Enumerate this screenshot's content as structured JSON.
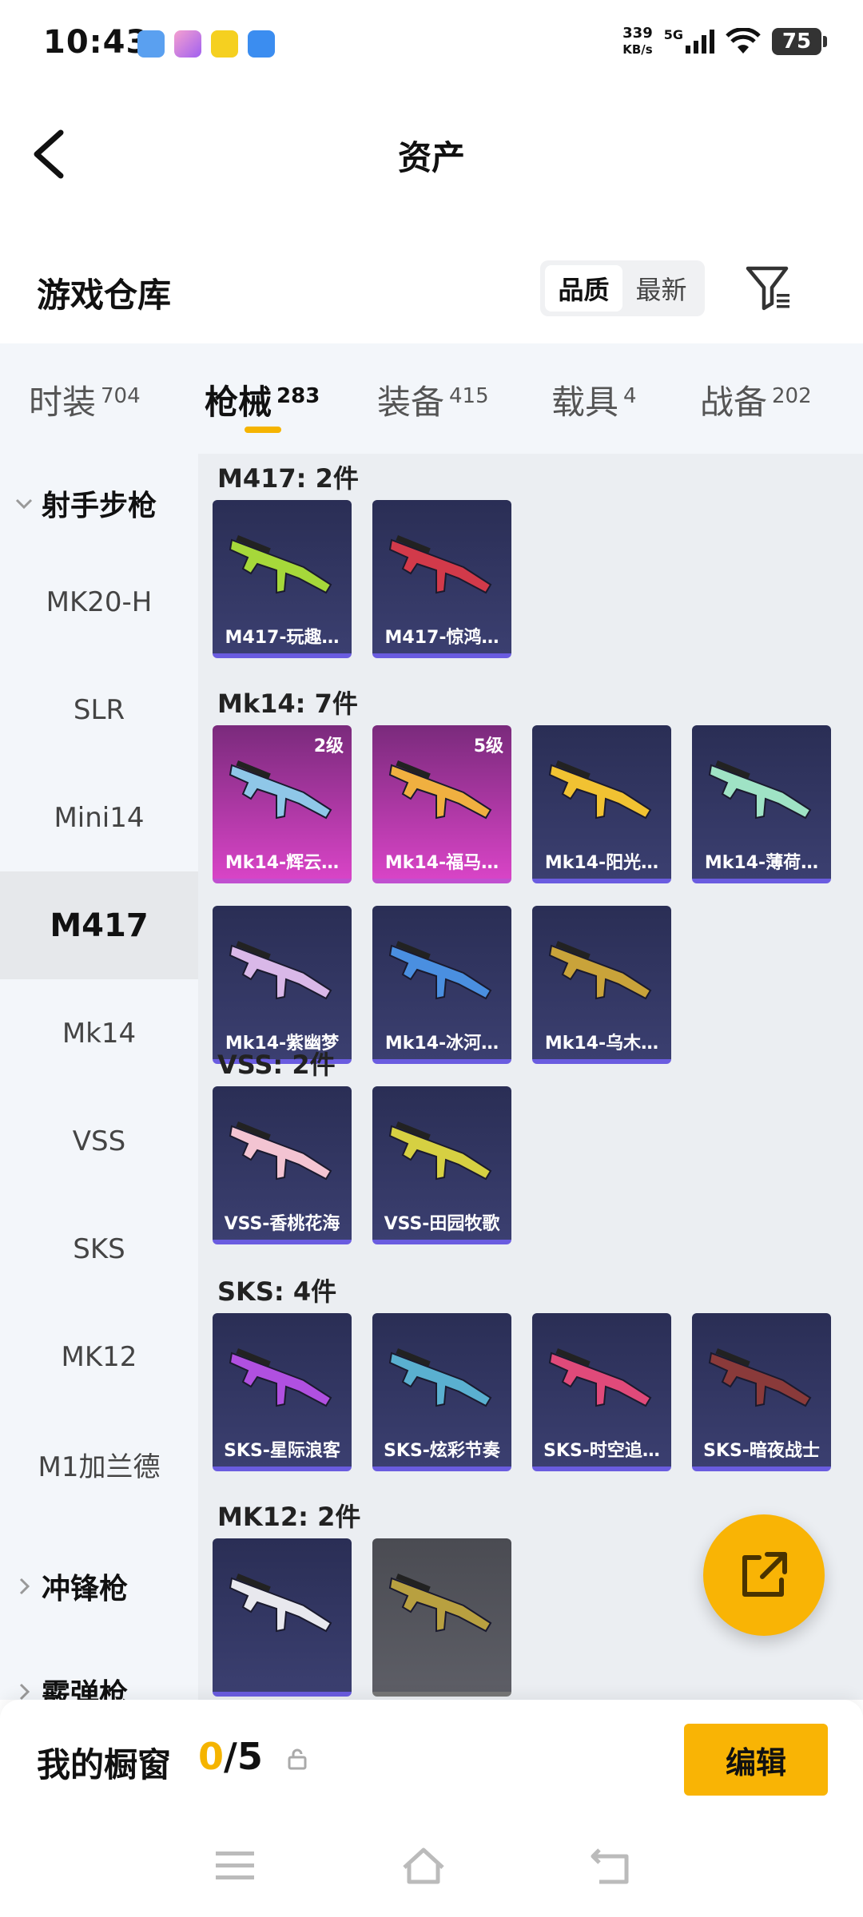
{
  "status": {
    "time": "10:43",
    "speed_value": "339",
    "speed_unit": "KB/s",
    "network": "5G",
    "battery": "75"
  },
  "header": {
    "title": "资产"
  },
  "section": {
    "title": "游戏仓库",
    "sort_options": [
      "品质",
      "最新"
    ],
    "sort_selected": "品质"
  },
  "tabs": [
    {
      "label": "时装",
      "count": "704"
    },
    {
      "label": "枪械",
      "count": "283"
    },
    {
      "label": "装备",
      "count": "415"
    },
    {
      "label": "载具",
      "count": "4"
    },
    {
      "label": "战备",
      "count": "202"
    }
  ],
  "active_tab": "枪械",
  "sidebar": {
    "category": "射手步枪",
    "items": [
      "MK20-H",
      "SLR",
      "Mini14",
      "M417",
      "Mk14",
      "VSS",
      "SKS",
      "MK12",
      "M1加兰德"
    ],
    "selected": "M417",
    "other_categories": [
      "冲锋枪",
      "霰弹枪"
    ]
  },
  "groups": [
    {
      "title": "M417: 2件",
      "items": [
        {
          "name": "M417-玩趣…",
          "level": "",
          "rarity": "epic",
          "color": "#a6d83a"
        },
        {
          "name": "M417-惊鸿…",
          "level": "",
          "rarity": "epic",
          "color": "#d23a4a"
        }
      ]
    },
    {
      "title": "Mk14: 7件",
      "items": [
        {
          "name": "Mk14-辉云…",
          "level": "2级",
          "rarity": "legend",
          "color": "#8fc7e8"
        },
        {
          "name": "Mk14-福马…",
          "level": "5级",
          "rarity": "legend",
          "color": "#f0b040"
        },
        {
          "name": "Mk14-阳光…",
          "level": "",
          "rarity": "epic",
          "color": "#f1c232"
        },
        {
          "name": "Mk14-薄荷…",
          "level": "",
          "rarity": "epic",
          "color": "#9fe3c5"
        },
        {
          "name": "Mk14-紫幽梦",
          "level": "",
          "rarity": "epic",
          "color": "#d9b8e8"
        },
        {
          "name": "Mk14-冰河…",
          "level": "",
          "rarity": "epic",
          "color": "#4a8fe0"
        },
        {
          "name": "Mk14-乌木…",
          "level": "",
          "rarity": "epic",
          "color": "#c9a33a"
        }
      ]
    },
    {
      "title": "VSS: 2件",
      "items": [
        {
          "name": "VSS-香桃花海",
          "level": "",
          "rarity": "epic",
          "color": "#f3c4d2"
        },
        {
          "name": "VSS-田园牧歌",
          "level": "",
          "rarity": "epic",
          "color": "#d6d042"
        }
      ]
    },
    {
      "title": "SKS: 4件",
      "items": [
        {
          "name": "SKS-星际浪客",
          "level": "",
          "rarity": "epic",
          "color": "#b050e0"
        },
        {
          "name": "SKS-炫彩节奏",
          "level": "",
          "rarity": "epic",
          "color": "#5ab0d0"
        },
        {
          "name": "SKS-时空追…",
          "level": "",
          "rarity": "epic",
          "color": "#e04a7a"
        },
        {
          "name": "SKS-暗夜战士",
          "level": "",
          "rarity": "epic",
          "color": "#8a3a3a"
        }
      ]
    },
    {
      "title": "MK12: 2件",
      "items": [
        {
          "name": "",
          "level": "",
          "rarity": "epic",
          "color": "#e8e8ee"
        },
        {
          "name": "",
          "level": "",
          "rarity": "common",
          "color": "#b8a040"
        }
      ]
    }
  ],
  "showcase": {
    "label": "我的橱窗",
    "current": "0",
    "separator": "/",
    "total": "5",
    "edit_label": "编辑"
  },
  "colors": {
    "accent": "#f9b405",
    "epic_card": "#2f3360",
    "legend_card": "#b63cb0"
  }
}
